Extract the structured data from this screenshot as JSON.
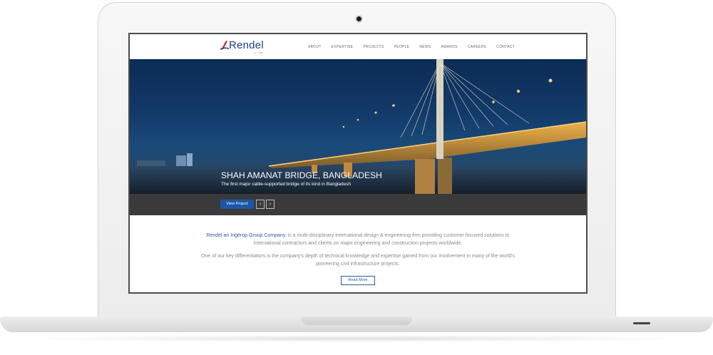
{
  "brand": {
    "name": "Rendel",
    "tagline": "est. 1838"
  },
  "nav": {
    "items": [
      "ABOUT",
      "EXPERTISE",
      "PROJECTS",
      "PEOPLE",
      "NEWS",
      "AWARDS",
      "CAREERS",
      "CONTACT"
    ]
  },
  "hero": {
    "title_main": "SHAH AMANAT BRIDGE,",
    "title_location": " BANGLADESH",
    "subtitle": "The first major cable-supported bridge of its kind in Bangladesh",
    "cta_label": "View Project",
    "prev_glyph": "‹",
    "next_glyph": "›"
  },
  "intro": {
    "company_link": "Rendel an Ingérop Group Company",
    "paragraph1_rest": ", is a multi-disciplinary international design & engineering firm providing customer focused solutions to international contractors and clients on major engineering and construction projects worldwide.",
    "paragraph2": "One of our key differentiators is the company's depth of technical knowledge and expertise gained from our involvement in many of the world's pioneering civil infrastructure projects.",
    "read_more_label": "Read More"
  },
  "colors": {
    "accent": "#1c57a5",
    "link": "#2d5aa0",
    "logo_red": "#c9252c"
  }
}
